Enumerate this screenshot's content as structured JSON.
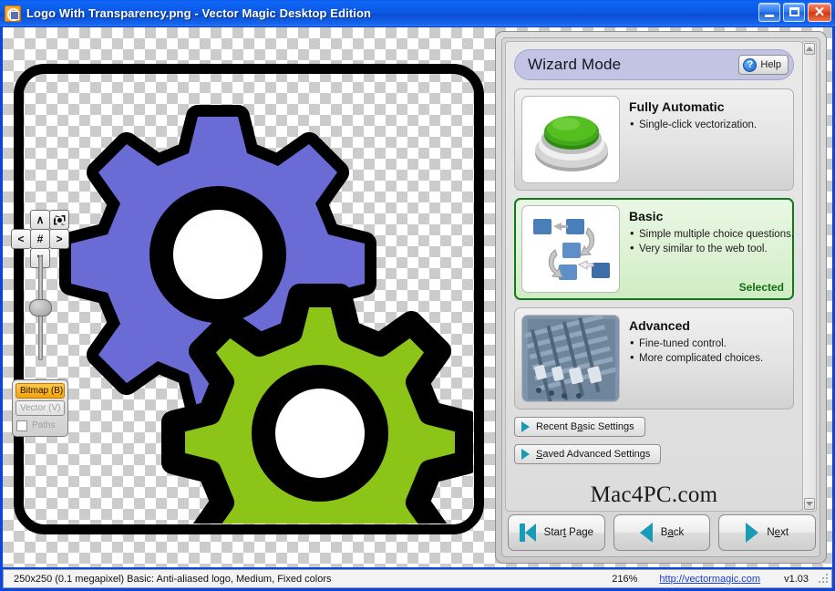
{
  "window": {
    "title": "Logo With Transparency.png - Vector Magic Desktop Edition",
    "app_icon": "vector-magic-icon",
    "minimize_label": "",
    "maximize_label": "",
    "close_label": "✕"
  },
  "canvas": {
    "pan": {
      "up": "∧",
      "down": "∨",
      "left": "<",
      "right": ">",
      "center": "#",
      "fit": "fit-to-view-icon"
    },
    "layers": {
      "bitmap_label": "Bitmap (B)",
      "vector_label": "Vector (V)",
      "paths_label": "Paths",
      "paths_checked": false
    },
    "artwork": {
      "description": "two interlocking gears logo on transparent background",
      "gear_purple_color": "#6B6BD6",
      "gear_green_color": "#8CC417",
      "outline_color": "#000000",
      "frame_color": "#000000"
    }
  },
  "panel": {
    "header": {
      "title": "Wizard Mode",
      "help_label": "Help",
      "help_icon": "question-mark-icon",
      "background_color": "#C3C3E4"
    },
    "modes": [
      {
        "title": "Fully Automatic",
        "bullets": [
          "Single-click vectorization."
        ],
        "thumb": "green-push-button",
        "selected": false,
        "selected_label": ""
      },
      {
        "title": "Basic",
        "bullets": [
          "Simple multiple choice questions.",
          "Very similar to the web tool."
        ],
        "thumb": "flow-diagram-blue-boxes",
        "selected": true,
        "selected_label": "Selected"
      },
      {
        "title": "Advanced",
        "bullets": [
          "Fine-tuned control.",
          "More complicated choices."
        ],
        "thumb": "audio-mixing-console",
        "selected": false,
        "selected_label": ""
      }
    ],
    "settings_buttons": [
      {
        "prefix": "Recent B",
        "accesskey": "a",
        "suffix": "sic Settings",
        "icon": "triangle-right-icon"
      },
      {
        "prefix": "",
        "accesskey": "S",
        "suffix": "aved Advanced Settings",
        "icon": "triangle-right-icon"
      }
    ],
    "watermark": "Mac4PC.com",
    "selected_border_color": "#0F7A16",
    "accent_color": "#1A9BB5"
  },
  "nav": {
    "start": {
      "prefix": "Star",
      "accesskey": "t",
      "suffix": " Page",
      "icon": "start-page-icon"
    },
    "back": {
      "prefix": "B",
      "accesskey": "a",
      "suffix": "ck",
      "icon": "triangle-left-icon"
    },
    "next": {
      "prefix": "N",
      "accesskey": "e",
      "suffix": "xt",
      "icon": "triangle-right-icon"
    }
  },
  "status": {
    "info": "250x250 (0.1 megapixel)  Basic: Anti-aliased logo, Medium, Fixed colors",
    "zoom": "216%",
    "link": "http://vectormagic.com",
    "version": "v1.03"
  }
}
